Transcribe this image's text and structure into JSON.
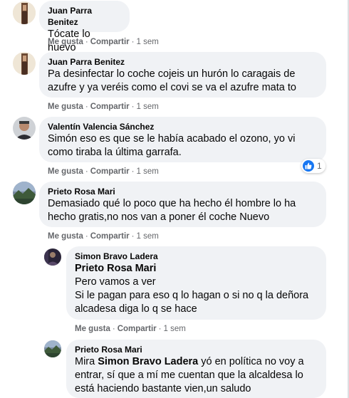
{
  "comments": [
    {
      "author": "Juan Parra Benitez",
      "text": "Tócate lo huevo",
      "like": "Me gusta",
      "reply": "Compartir",
      "time": "1 sem"
    },
    {
      "author": "Juan Parra Benitez",
      "text": "Pa desinfectar lo coche cojeis un hurón lo caragais de azufre y ya veréis como el covi se va el azufre mata to",
      "like": "Me gusta",
      "reply": "Compartir",
      "time": "1 sem"
    },
    {
      "author": "Valentín Valencia Sánchez",
      "text": "Simón eso es que se le había acabado el ozono, yo vi como tiraba la última garrafa.",
      "like": "Me gusta",
      "reply": "Compartir",
      "time": "1 sem",
      "reaction_count": "1"
    },
    {
      "author": "Prieto Rosa Mari",
      "text": "Demasiado qué lo poco que ha hecho él hombre lo ha hecho gratis,no nos van a poner él coche Nuevo",
      "like": "Me gusta",
      "reply": "Compartir",
      "time": "1 sem"
    }
  ],
  "replies": [
    {
      "author": "Simon Bravo Ladera",
      "mention": "Prieto Rosa Mari",
      "text": "Pero vamos a ver\nSi le pagan para eso q lo hagan o si no q la deñora alcadesa diga lo q se hace",
      "like": "Me gusta",
      "reply": "Compartir",
      "time": "1 sem"
    },
    {
      "author": "Prieto Rosa Mari",
      "prefix": "Mira ",
      "mention": "Simon Bravo Ladera",
      "text": " yó en política no voy a entrar, sí que a mí me cuentan que la alcaldesa lo está haciendo bastante vien,un saludo"
    }
  ],
  "separator": "·",
  "colors": {
    "bubble": "#f0f2f5",
    "meta": "#65676b",
    "like_blue": "#1877f2"
  }
}
